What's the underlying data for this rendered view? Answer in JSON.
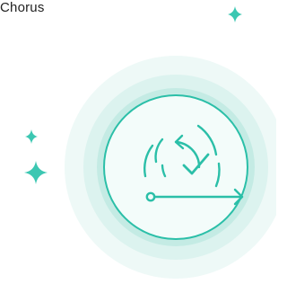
{
  "app": {
    "title": "Chorus"
  },
  "illustration": {
    "icon": "recurring-task-check-icon",
    "decorations": [
      "sparkle-icon",
      "sparkle-icon",
      "sparkle-icon"
    ],
    "colors": {
      "accent": "#2bbfa8",
      "ring_outer": "#eef9f7",
      "ring_middle": "#dcf3ef",
      "ring_inner": "#c4ebe4",
      "disc": "#f3fcfa",
      "sparkle": "#3cc7b2"
    }
  }
}
